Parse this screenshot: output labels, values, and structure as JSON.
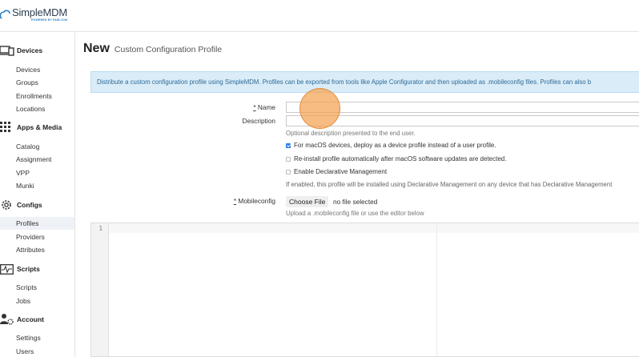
{
  "app": {
    "logo_name": "SimpleMDM",
    "logo_sub": "POWERED BY PAW.COM"
  },
  "sidebar": {
    "sections": [
      {
        "title": "Devices",
        "icon": "devices-icon",
        "items": [
          {
            "label": "Devices"
          },
          {
            "label": "Groups"
          },
          {
            "label": "Enrollments"
          },
          {
            "label": "Locations"
          }
        ]
      },
      {
        "title": "Apps & Media",
        "icon": "apps-grid-icon",
        "items": [
          {
            "label": "Catalog"
          },
          {
            "label": "Assignment"
          },
          {
            "label": "VPP"
          },
          {
            "label": "Munki"
          }
        ]
      },
      {
        "title": "Configs",
        "icon": "gear-icon",
        "items": [
          {
            "label": "Profiles"
          },
          {
            "label": "Providers"
          },
          {
            "label": "Attributes"
          }
        ]
      },
      {
        "title": "Scripts",
        "icon": "terminal-icon",
        "items": [
          {
            "label": "Scripts"
          },
          {
            "label": "Jobs"
          }
        ]
      },
      {
        "title": "Account",
        "icon": "account-icon",
        "items": [
          {
            "label": "Settings"
          },
          {
            "label": "Users"
          }
        ]
      }
    ],
    "active_item": "Profiles"
  },
  "page": {
    "title": "New",
    "subtitle": "Custom Configuration Profile",
    "info": "Distribute a custom configuration profile using SimpleMDM. Profiles can be exported from tools like Apple Configurator and then uploaded as .mobileconfig files. Profiles can also b"
  },
  "form": {
    "required_mark": "*",
    "name_label": "Name",
    "name_value": "",
    "description_label": "Description",
    "description_value": "",
    "description_help": "Optional description presented to the end user.",
    "checkbox_device": {
      "label": "For macOS devices, deploy as a device profile instead of a user profile.",
      "checked": true
    },
    "checkbox_reinstall": {
      "label": "Re-install profile automatically after macOS software updates are detected.",
      "checked": false
    },
    "checkbox_declarative": {
      "label": "Enable Declarative Management",
      "checked": false
    },
    "declarative_help": "If enabled, this profile will be installed using Declarative Management on any device that has Declarative Management",
    "mobileconfig_label": "Mobileconfig",
    "choose_file_label": "Choose File",
    "file_status": "no file selected",
    "upload_help": "Upload a .mobileconfig file or use the editor below"
  },
  "editor": {
    "line_numbers": [
      "1"
    ],
    "content": ""
  }
}
